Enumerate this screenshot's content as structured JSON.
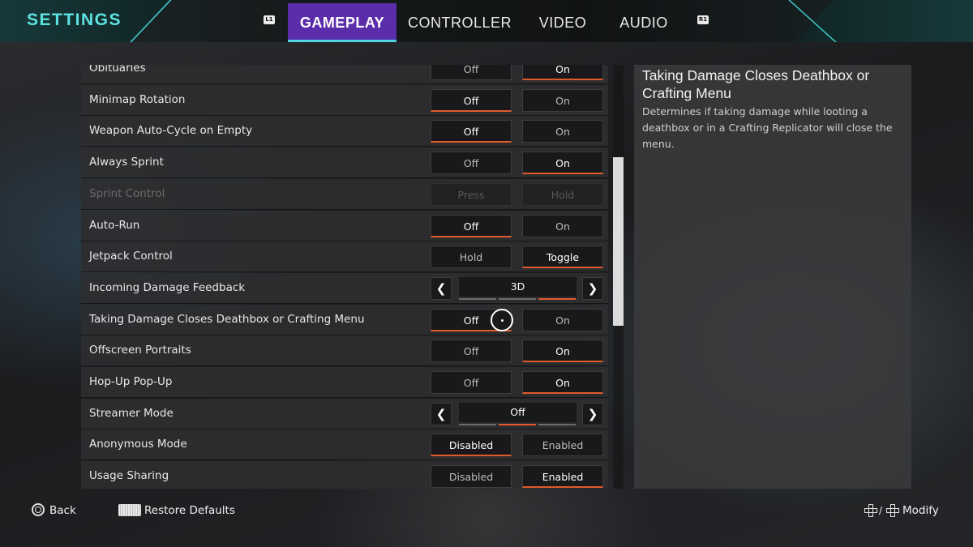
{
  "header": {
    "title": "SETTINGS",
    "left_bumper": "L1",
    "right_bumper": "R1",
    "tabs": [
      "GAMEPLAY",
      "CONTROLLER",
      "VIDEO",
      "AUDIO"
    ],
    "active_tab": "GAMEPLAY"
  },
  "settings": [
    {
      "label": "Obituaries",
      "options": [
        "Off",
        "On"
      ],
      "selected": "On"
    },
    {
      "label": "Minimap Rotation",
      "options": [
        "Off",
        "On"
      ],
      "selected": "Off"
    },
    {
      "label": "Weapon Auto-Cycle on Empty",
      "options": [
        "Off",
        "On"
      ],
      "selected": "Off"
    },
    {
      "label": "Always Sprint",
      "options": [
        "Off",
        "On"
      ],
      "selected": "On"
    },
    {
      "label": "Sprint Control",
      "options": [
        "Press",
        "Hold"
      ],
      "selected": "",
      "disabled": true
    },
    {
      "label": "Auto-Run",
      "options": [
        "Off",
        "On"
      ],
      "selected": "Off"
    },
    {
      "label": "Jetpack Control",
      "options": [
        "Hold",
        "Toggle"
      ],
      "selected": "Toggle"
    },
    {
      "label": "Incoming Damage Feedback",
      "carousel": true,
      "value": "3D",
      "segments": 3,
      "active_segment": 2
    },
    {
      "label": "Taking Damage Closes Deathbox or Crafting Menu",
      "options": [
        "Off",
        "On"
      ],
      "selected": "Off"
    },
    {
      "label": "Offscreen Portraits",
      "options": [
        "Off",
        "On"
      ],
      "selected": "On"
    },
    {
      "label": "Hop-Up Pop-Up",
      "options": [
        "Off",
        "On"
      ],
      "selected": "On"
    },
    {
      "label": "Streamer Mode",
      "carousel": true,
      "value": "Off",
      "segments": 3,
      "active_segment": 1
    },
    {
      "label": "Anonymous Mode",
      "options": [
        "Disabled",
        "Enabled"
      ],
      "selected": "Disabled"
    },
    {
      "label": "Usage Sharing",
      "options": [
        "Disabled",
        "Enabled"
      ],
      "selected": "Enabled"
    }
  ],
  "description": {
    "title": "Taking Damage Closes Deathbox or Crafting Menu",
    "body": "Determines if taking damage while looting a deathbox or in a Crafting Replicator will close the menu."
  },
  "footer": {
    "back": "Back",
    "restore": "Restore Defaults",
    "modify": "Modify",
    "modify_separator": "/"
  },
  "icons": {
    "back": "circle-button-icon",
    "restore": "touchpad-icon",
    "modify": "dpad-icon"
  },
  "colors": {
    "accent_cyan": "#5de3e0",
    "tab_active": "#5b2dab",
    "selected_underline": "#e05a2b"
  }
}
